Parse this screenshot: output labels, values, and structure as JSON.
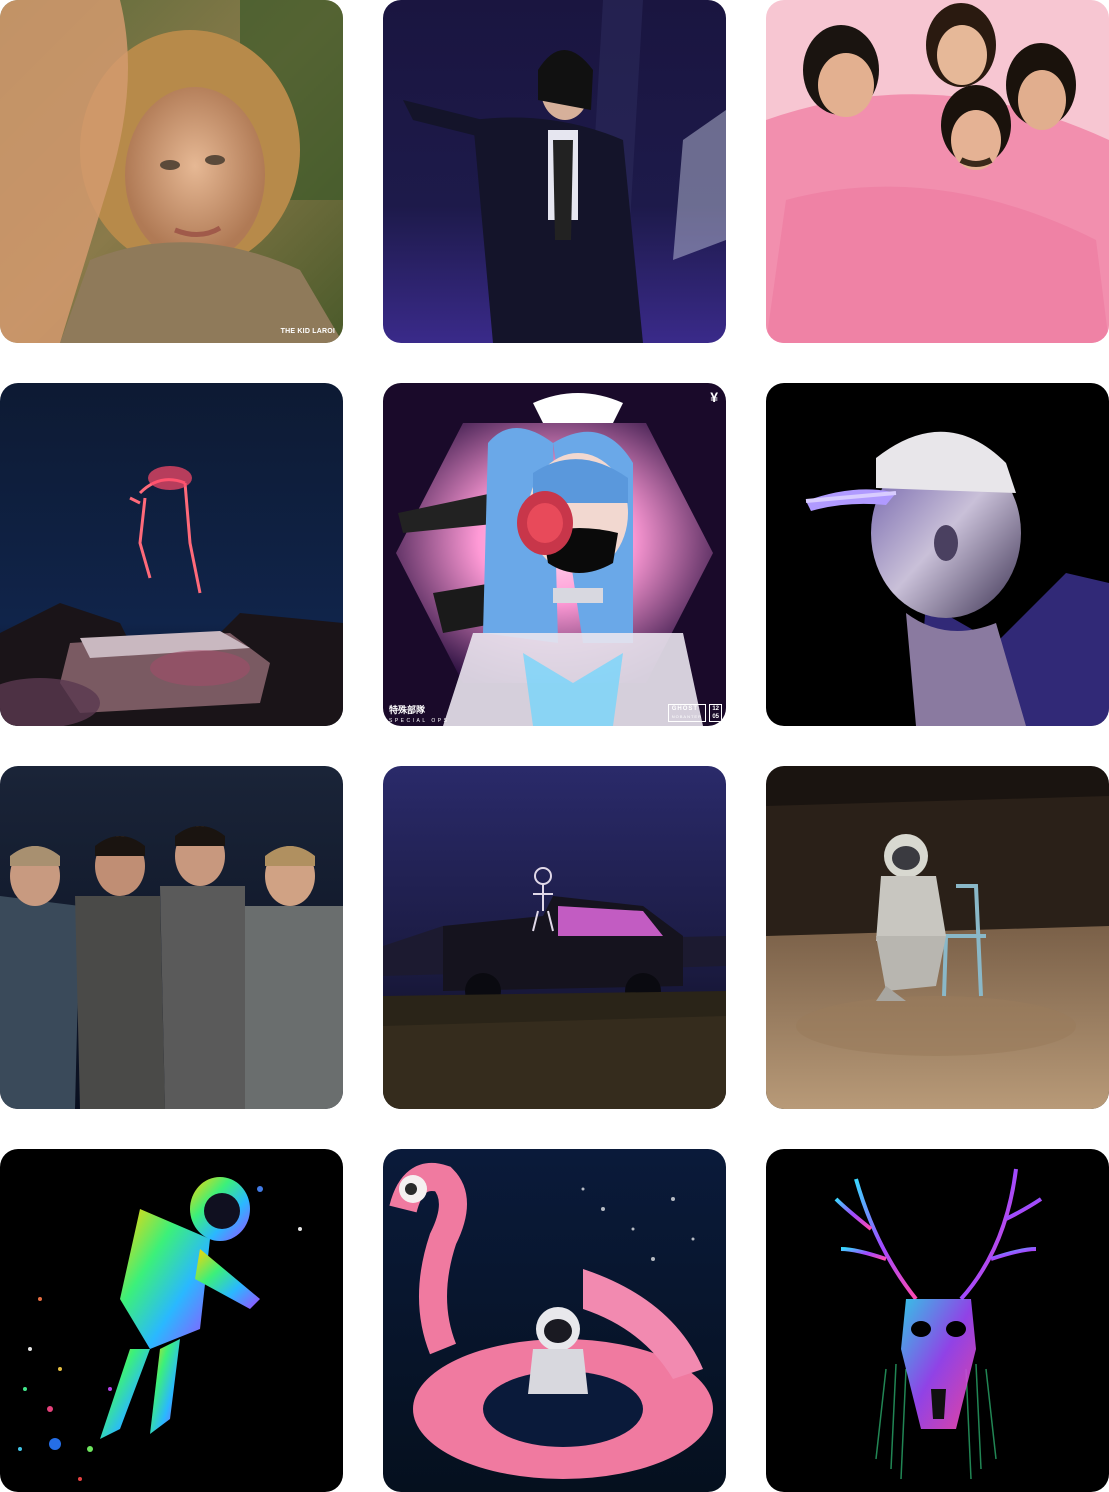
{
  "grid": {
    "tiles": [
      {
        "subject": "kid-laroi-cover",
        "caption": "THE KID LAROI"
      },
      {
        "subject": "performer-stage-cover"
      },
      {
        "subject": "pink-band-cover"
      },
      {
        "subject": "floating-skeleton-cover"
      },
      {
        "subject": "special-ops-anime-cover",
        "title": "特殊部隊",
        "subtitle": "SPECIAL OPS",
        "badge": "GHOST",
        "badge_sub": "NOBANTER",
        "number_top": "12",
        "number_bottom": "05",
        "mark": "¥"
      },
      {
        "subject": "mannequin-cap-cover"
      },
      {
        "subject": "band-portrait-cover"
      },
      {
        "subject": "skeleton-car-cover"
      },
      {
        "subject": "astronaut-chair-cover"
      },
      {
        "subject": "rainbow-astronaut-cover"
      },
      {
        "subject": "flamingo-float-cover"
      },
      {
        "subject": "neon-stag-skull-cover"
      }
    ]
  },
  "colors": {
    "background": "#ffffff",
    "pink": "#f4a0b8",
    "night_blue": "#0f1a3a",
    "neon_purple": "#8a5cff"
  }
}
